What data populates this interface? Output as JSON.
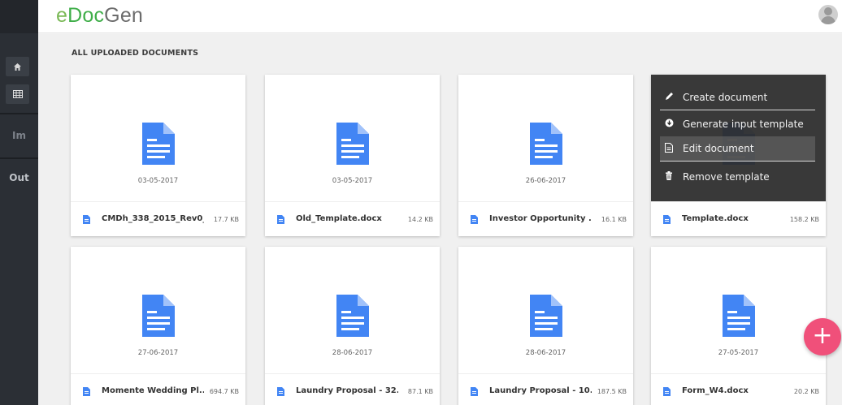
{
  "app": {
    "logo_e": "e",
    "logo_doc": "Doc",
    "logo_gen": "Gen"
  },
  "sidebar": {
    "im_label": "Im",
    "out_label": "Out"
  },
  "section": {
    "title": "ALL UPLOADED DOCUMENTS"
  },
  "context_menu": {
    "create": "Create document",
    "generate": "Generate input template",
    "edit": "Edit document",
    "remove": "Remove template"
  },
  "documents": [
    {
      "name": "CMDh_338_2015_Rev0_...",
      "size": "17.7 KB",
      "date": "03-05-2017"
    },
    {
      "name": "Old_Template.docx",
      "size": "14.2 KB",
      "date": "03-05-2017"
    },
    {
      "name": "Investor Opportunity ...",
      "size": "16.1 KB",
      "date": "26-06-2017"
    },
    {
      "name": "Template.docx",
      "size": "158.2 KB",
      "date": ""
    },
    {
      "name": "Momente Wedding Pl...",
      "size": "694.7 KB",
      "date": "27-06-2017"
    },
    {
      "name": "Laundry Proposal - 32...",
      "size": "87.1 KB",
      "date": "28-06-2017"
    },
    {
      "name": "Laundry Proposal - 10...",
      "size": "187.5 KB",
      "date": "28-06-2017"
    },
    {
      "name": "Form_W4.docx",
      "size": "20.2 KB",
      "date": "27-05-2017"
    }
  ],
  "fab": {
    "label": "+"
  },
  "colors": {
    "accent": "#4285f4",
    "fab": "#f0507a",
    "brand_green": "#3fae49"
  }
}
